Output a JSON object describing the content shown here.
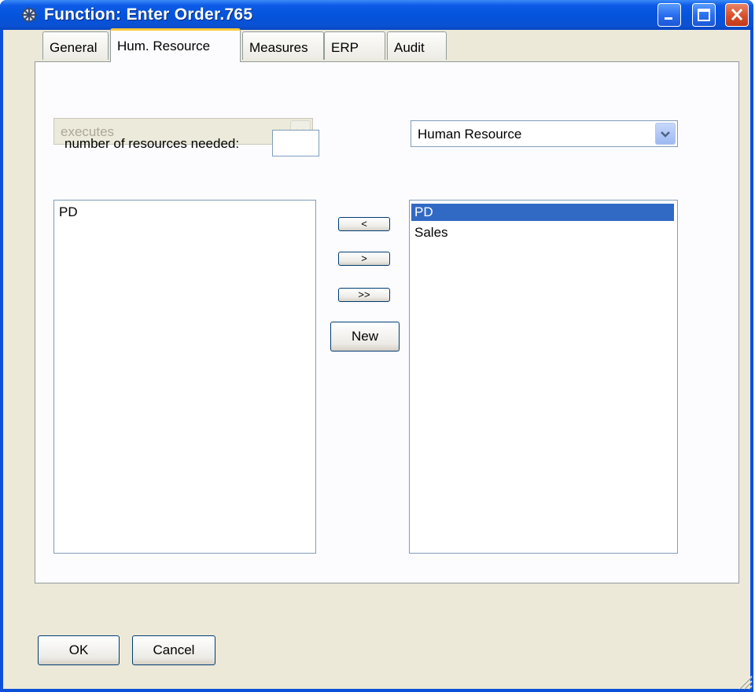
{
  "window": {
    "title": "Function: Enter Order.765",
    "title_color": "#ffffff",
    "controls": [
      "minimize-icon",
      "maximize-icon",
      "close-icon"
    ]
  },
  "tabs": [
    {
      "label": "General",
      "active": false
    },
    {
      "label": "Hum. Resource",
      "active": true
    },
    {
      "label": "Measures",
      "active": false
    },
    {
      "label": "ERP",
      "active": false
    },
    {
      "label": "Audit",
      "active": false
    }
  ],
  "relation_combo": {
    "value": "executes",
    "enabled": false
  },
  "type_combo": {
    "value": "Human Resource",
    "enabled": true
  },
  "resources_needed": {
    "label": "number of resources needed:",
    "value": ""
  },
  "assigned_list": {
    "items": [
      "PD"
    ]
  },
  "available_list": {
    "items": [
      "PD",
      "Sales"
    ],
    "selected_index": 0
  },
  "move_buttons": {
    "left": "<",
    "right": ">",
    "all_right": ">>",
    "new": "New"
  },
  "footer": {
    "ok": "OK",
    "cancel": "Cancel"
  },
  "colors": {
    "selection": "#316ac5",
    "window_face": "#ece9d8",
    "titlebar": "#0453db",
    "tab_highlight": "#ffc83c"
  }
}
